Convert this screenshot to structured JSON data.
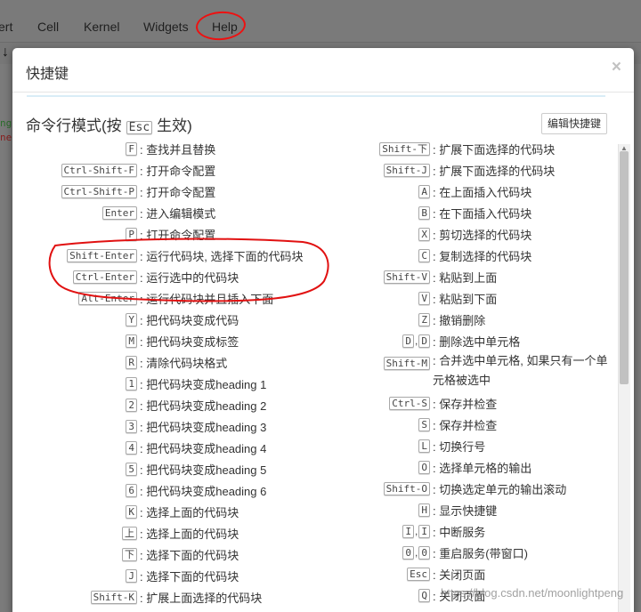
{
  "background": {
    "menu": [
      "ert",
      "Cell",
      "Kernel",
      "Widgets",
      "Help"
    ],
    "code_snippets": [
      "ng",
      "nel"
    ]
  },
  "modal": {
    "title": "快捷键",
    "close_label": "×",
    "section_title_before": "命令行模式(按",
    "section_title_key": "Esc",
    "section_title_after": "生效)",
    "edit_button": "编辑快捷键"
  },
  "shortcuts_left": [
    {
      "keys": [
        "F"
      ],
      "desc": "查找并且替换"
    },
    {
      "keys": [
        "Ctrl-Shift-F"
      ],
      "desc": "打开命令配置"
    },
    {
      "keys": [
        "Ctrl-Shift-P"
      ],
      "desc": "打开命令配置"
    },
    {
      "keys": [
        "Enter"
      ],
      "desc": "进入编辑模式"
    },
    {
      "keys": [
        "P"
      ],
      "desc": "打开命令配置"
    },
    {
      "keys": [
        "Shift-Enter"
      ],
      "desc": "运行代码块, 选择下面的代码块"
    },
    {
      "keys": [
        "Ctrl-Enter"
      ],
      "desc": "运行选中的代码块"
    },
    {
      "keys": [
        "Alt-Enter"
      ],
      "desc": "运行代码块并且插入下面"
    },
    {
      "keys": [
        "Y"
      ],
      "desc": "把代码块变成代码"
    },
    {
      "keys": [
        "M"
      ],
      "desc": "把代码块变成标签"
    },
    {
      "keys": [
        "R"
      ],
      "desc": "清除代码块格式"
    },
    {
      "keys": [
        "1"
      ],
      "desc": "把代码块变成heading 1"
    },
    {
      "keys": [
        "2"
      ],
      "desc": "把代码块变成heading 2"
    },
    {
      "keys": [
        "3"
      ],
      "desc": "把代码块变成heading 3"
    },
    {
      "keys": [
        "4"
      ],
      "desc": "把代码块变成heading 4"
    },
    {
      "keys": [
        "5"
      ],
      "desc": "把代码块变成heading 5"
    },
    {
      "keys": [
        "6"
      ],
      "desc": "把代码块变成heading 6"
    },
    {
      "keys": [
        "K"
      ],
      "desc": "选择上面的代码块"
    },
    {
      "keys": [
        "上"
      ],
      "desc": "选择上面的代码块"
    },
    {
      "keys": [
        "下"
      ],
      "desc": "选择下面的代码块"
    },
    {
      "keys": [
        "J"
      ],
      "desc": "选择下面的代码块"
    },
    {
      "keys": [
        "Shift-K"
      ],
      "desc": "扩展上面选择的代码块"
    }
  ],
  "shortcuts_right": [
    {
      "keys": [
        "Shift-下"
      ],
      "desc": "扩展下面选择的代码块"
    },
    {
      "keys": [
        "Shift-J"
      ],
      "desc": "扩展下面选择的代码块"
    },
    {
      "keys": [
        "A"
      ],
      "desc": "在上面插入代码块"
    },
    {
      "keys": [
        "B"
      ],
      "desc": "在下面插入代码块"
    },
    {
      "keys": [
        "X"
      ],
      "desc": "剪切选择的代码块"
    },
    {
      "keys": [
        "C"
      ],
      "desc": "复制选择的代码块"
    },
    {
      "keys": [
        "Shift-V"
      ],
      "desc": "粘贴到上面"
    },
    {
      "keys": [
        "V"
      ],
      "desc": "粘贴到下面"
    },
    {
      "keys": [
        "Z"
      ],
      "desc": "撤销删除"
    },
    {
      "keys": [
        "D",
        "D"
      ],
      "desc": "删除选中单元格"
    },
    {
      "keys": [
        "Shift-M"
      ],
      "desc": "合并选中单元格, 如果只有一个单元格被选中"
    },
    {
      "keys": [
        "Ctrl-S"
      ],
      "desc": "保存并检查"
    },
    {
      "keys": [
        "S"
      ],
      "desc": "保存并检查"
    },
    {
      "keys": [
        "L"
      ],
      "desc": "切换行号"
    },
    {
      "keys": [
        "O"
      ],
      "desc": "选择单元格的输出"
    },
    {
      "keys": [
        "Shift-O"
      ],
      "desc": "切换选定单元的输出滚动"
    },
    {
      "keys": [
        "H"
      ],
      "desc": "显示快捷键"
    },
    {
      "keys": [
        "I",
        "I"
      ],
      "desc": "中断服务"
    },
    {
      "keys": [
        "0",
        "0"
      ],
      "desc": "重启服务(带窗口)"
    },
    {
      "keys": [
        "Esc"
      ],
      "desc": "关闭页面"
    },
    {
      "keys": [
        "Q"
      ],
      "desc": "关闭页面"
    }
  ],
  "watermark": "https://blog.csdn.net/moonlightpeng",
  "colors": {
    "annotation": "#e11111",
    "modal_bg": "#ffffff"
  }
}
